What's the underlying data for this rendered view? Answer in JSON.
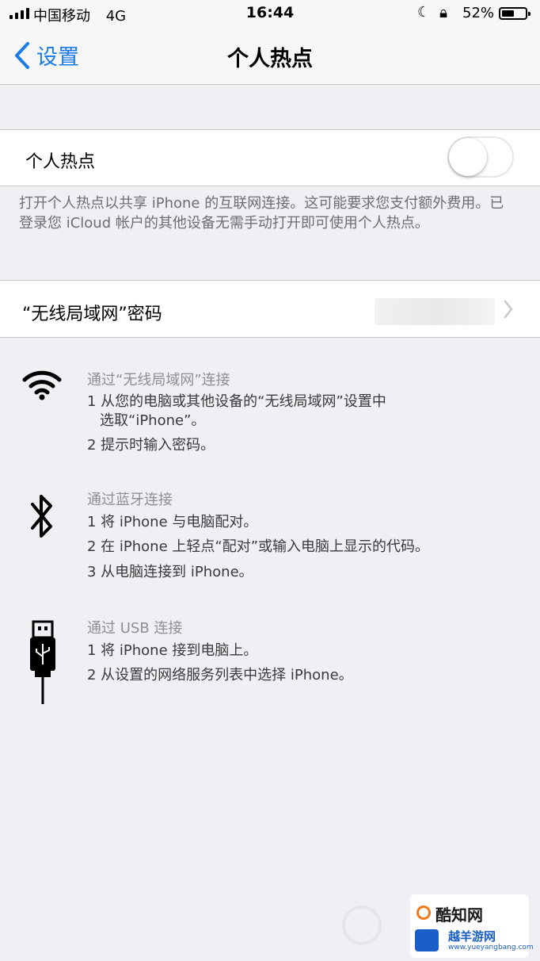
{
  "status_bar": {
    "carrier": "中国移动",
    "network": "4G",
    "time": "16:44",
    "battery_percent": "52%",
    "battery_level": 0.52
  },
  "nav": {
    "back_label": "设置",
    "title": "个人热点"
  },
  "hotspot": {
    "label": "个人热点",
    "enabled": false,
    "footer": "打开个人热点以共享 iPhone 的互联网连接。这可能要求您支付额外费用。已登录您 iCloud 帐户的其他设备无需手动打开即可使用个人热点。"
  },
  "wifi_password": {
    "label": "“无线局域网”密码"
  },
  "instructions": {
    "wifi": {
      "icon": "wifi-icon",
      "heading": "通过“无线局域网”连接",
      "step1": "1 从您的电脑或其他设备的“无线局域网”设置中",
      "step1_cont": "选取“iPhone”。",
      "step2": "2 提示时输入密码。"
    },
    "bluetooth": {
      "icon": "bluetooth-icon",
      "heading": "通过蓝牙连接",
      "step1": "1 将 iPhone 与电脑配对。",
      "step2": "2 在 iPhone 上轻点“配对”或输入电脑上显示的代码。",
      "step3": "3 从电脑连接到 iPhone。"
    },
    "usb": {
      "icon": "usb-cable-icon",
      "heading": "通过 USB 连接",
      "step1": "1 将 iPhone 接到电脑上。",
      "step2": "2 从设置的网络服务列表中选择 iPhone。"
    }
  },
  "watermark": {
    "line1": "酷知网",
    "line2": "越羊游网",
    "line3": "www.yueyangbang.com"
  },
  "colors": {
    "accent": "#1a7ae8",
    "background": "#efeff4"
  }
}
